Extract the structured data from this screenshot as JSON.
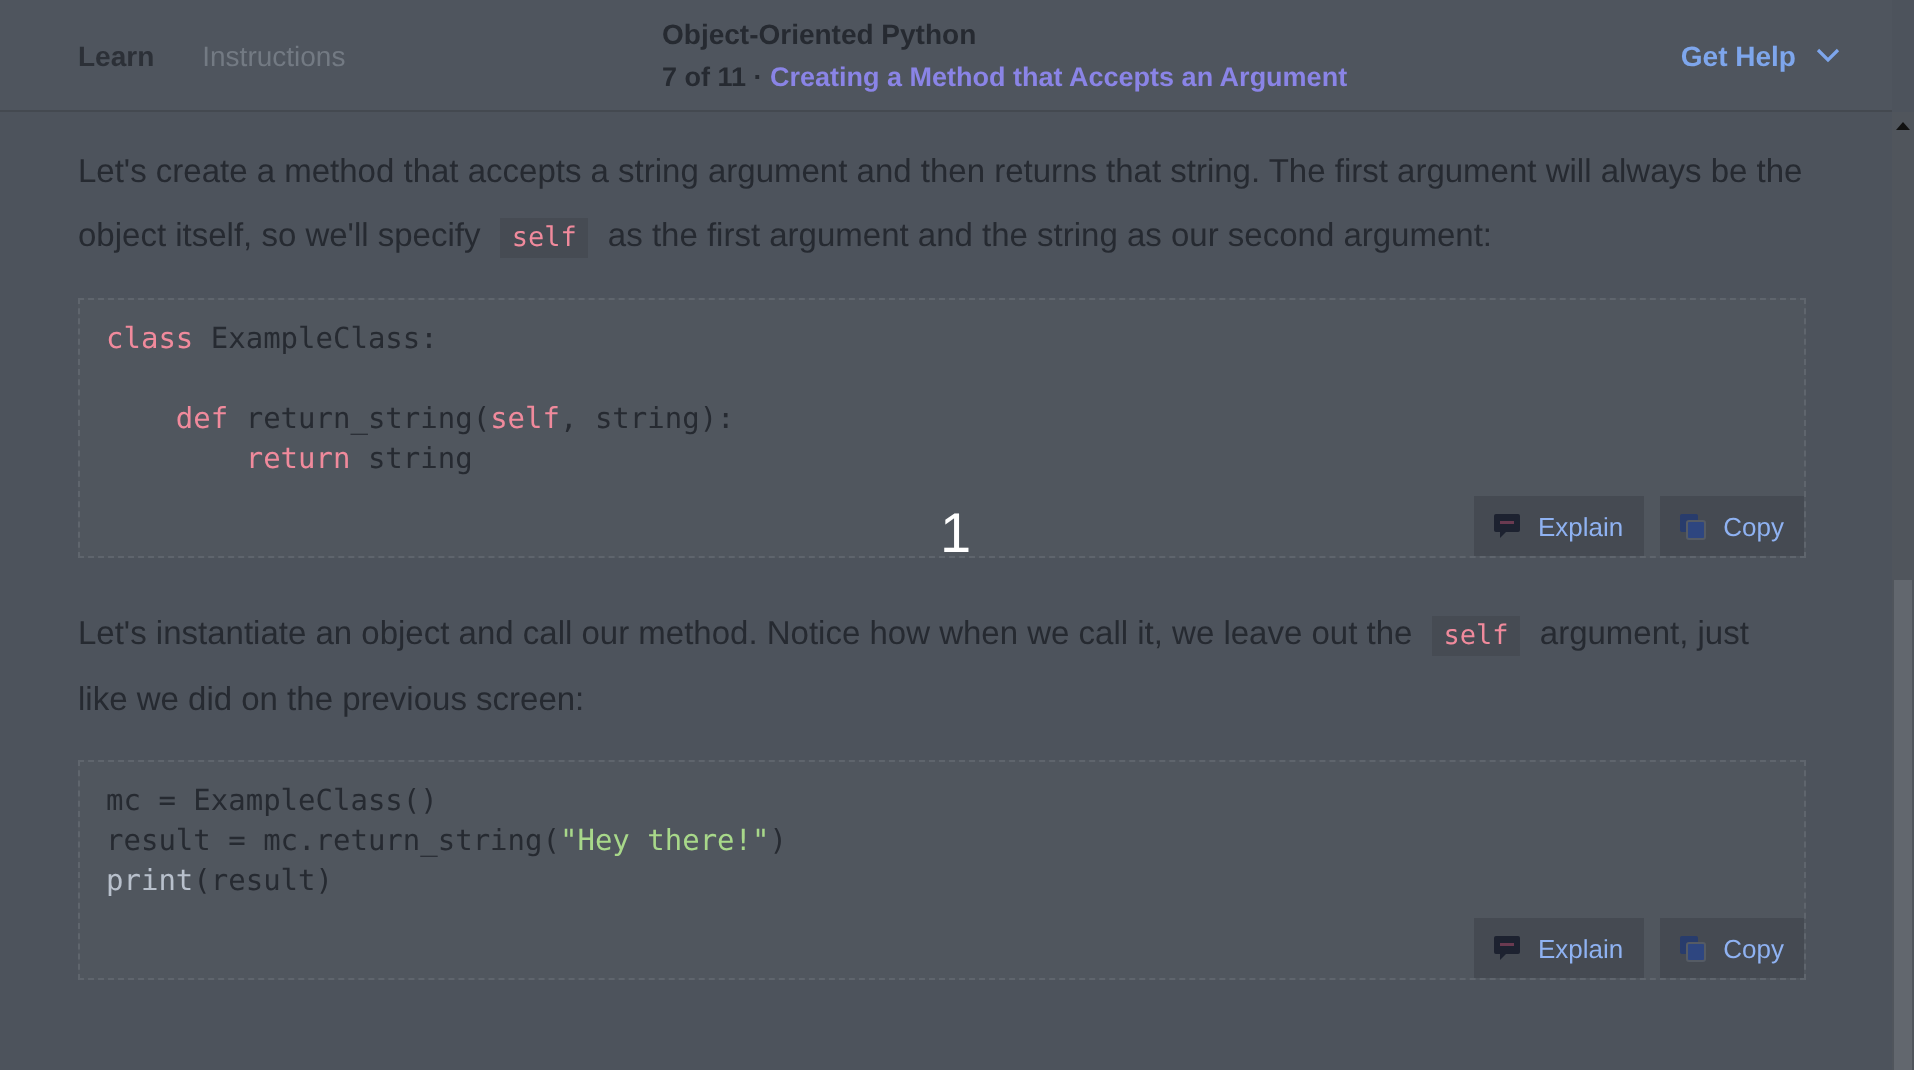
{
  "header": {
    "tabs": [
      {
        "label": "Learn",
        "selected": true
      },
      {
        "label": "Instructions",
        "selected": false
      }
    ],
    "course_title": "Object-Oriented Python",
    "progress": "7 of 11 · ",
    "screen_title": "Creating a Method that Accepts an Argument",
    "help": "Get Help"
  },
  "content": [
    {
      "kind": "paragraph",
      "parts": [
        {
          "kind": "text",
          "text": "Let's create a method that accepts a string argument and then returns that string. The first argument will always be the object itself, so we'll specify "
        },
        {
          "kind": "code",
          "text": "self"
        },
        {
          "kind": "text",
          "text": " as the first argument and the string as our second argument:"
        }
      ]
    },
    {
      "kind": "code",
      "lines": [
        {
          "kind": "code",
          "tokens": [
            {
              "kind": "keyword",
              "text": "class"
            },
            {
              "kind": "plain",
              "text": " ExampleClass:"
            }
          ]
        },
        {
          "kind": "blank"
        },
        {
          "kind": "code",
          "tokens": [
            {
              "kind": "keyword",
              "text": "    def"
            },
            {
              "kind": "plain",
              "text": " return_string("
            },
            {
              "kind": "keyword",
              "text": "self"
            },
            {
              "kind": "plain",
              "text": ", string):"
            }
          ]
        },
        {
          "kind": "code",
          "tokens": [
            {
              "kind": "keyword",
              "text": "        return"
            },
            {
              "kind": "plain",
              "text": " string"
            }
          ]
        }
      ],
      "buttons": [
        "Explain",
        "Copy"
      ]
    },
    {
      "kind": "paragraph",
      "parts": [
        {
          "kind": "text",
          "text": "Let's instantiate an object and call our method. Notice how when we call it, we leave out the "
        },
        {
          "kind": "code",
          "text": "self"
        },
        {
          "kind": "text",
          "text": " argument, just like we did on the previous screen:"
        }
      ]
    },
    {
      "kind": "code",
      "lines": [
        {
          "kind": "code",
          "tokens": [
            {
              "kind": "plain",
              "text": "mc = ExampleClass()"
            }
          ]
        },
        {
          "kind": "code",
          "tokens": [
            {
              "kind": "plain",
              "text": "result = mc.return_string("
            },
            {
              "kind": "string",
              "text": "\"Hey there!\""
            },
            {
              "kind": "plain",
              "text": ")"
            }
          ]
        },
        {
          "kind": "code",
          "tokens": [
            {
              "kind": "builtin",
              "text": "print"
            },
            {
              "kind": "plain",
              "text": "(result)"
            }
          ]
        }
      ],
      "buttons": [
        "Explain",
        "Copy"
      ]
    }
  ],
  "overlay": {
    "step": "1"
  }
}
